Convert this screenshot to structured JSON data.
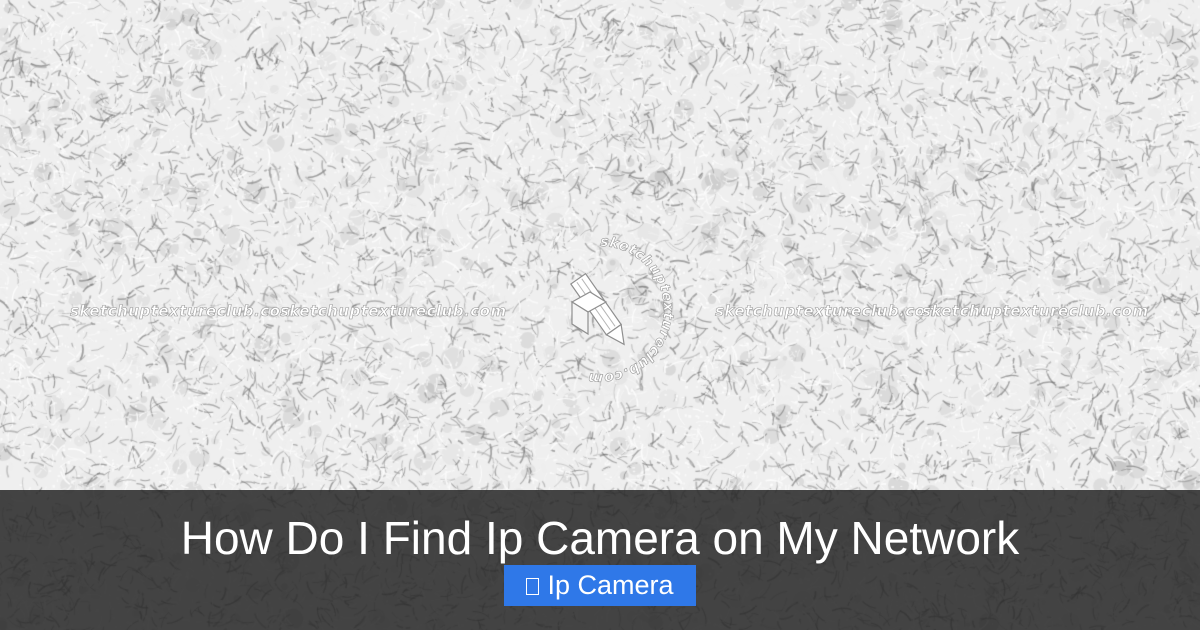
{
  "page": {
    "title": "How Do I Find Ip Camera on My Network",
    "category": {
      "label": "Ip Camera",
      "icon": "tag-icon",
      "color": "#2f78e8"
    },
    "banner_color": "#262626"
  },
  "watermark": {
    "text": "sketchuptextureclub.com"
  }
}
